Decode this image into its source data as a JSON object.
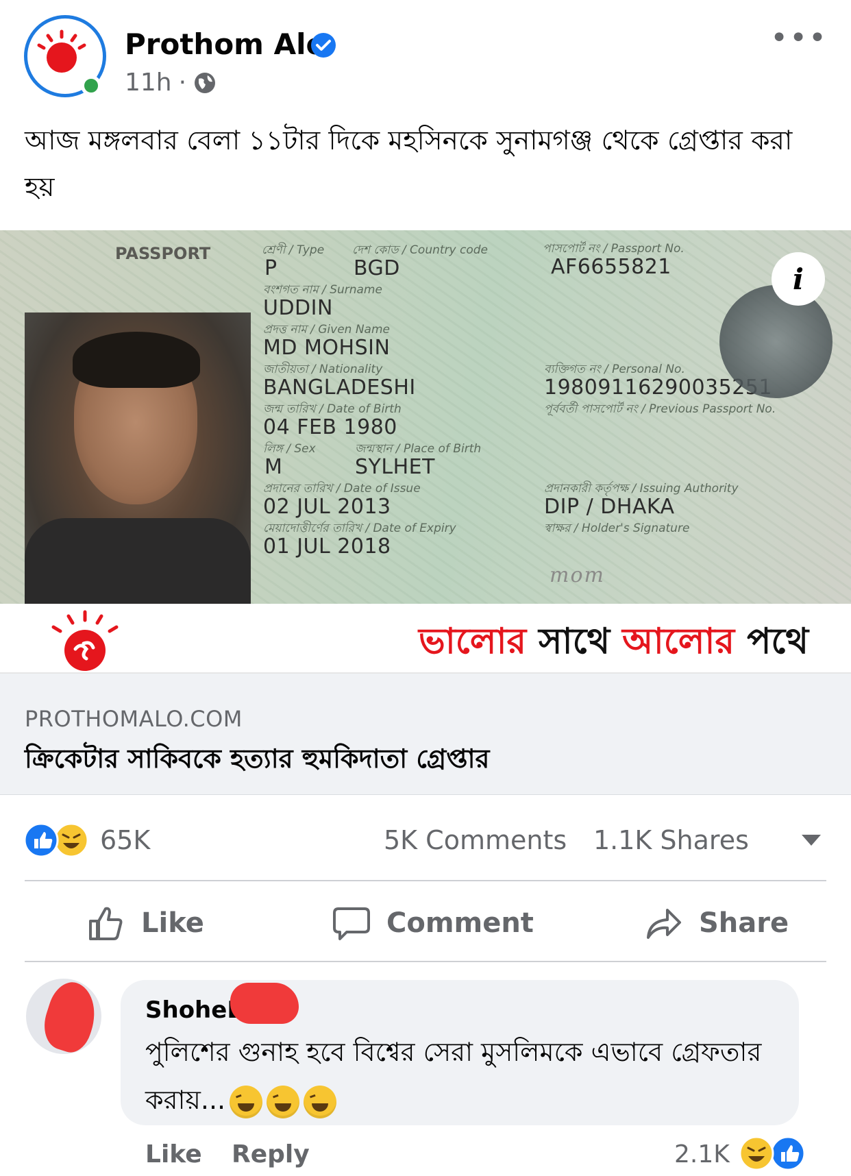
{
  "post": {
    "page_name": "Prothom Alo",
    "time": "11h",
    "separator": "·",
    "more": "•••",
    "caption": "আজ মঙ্গলবার বেলা ১১টার দিকে মহসিনকে সুনামগঞ্জ থেকে গ্রেপ্তার করা হয়"
  },
  "passport": {
    "header": "PASSPORT",
    "type_label": "শ্রেণী / Type",
    "type": "P",
    "country_label": "দেশ কোড / Country code",
    "country": "BGD",
    "number_label": "পাসপোর্ট নং / Passport No.",
    "number": "AF6655821",
    "surname_label": "বংশগত নাম / Surname",
    "surname": "UDDIN",
    "given_label": "প্রদত্ত নাম / Given Name",
    "given": "MD MOHSIN",
    "nationality_label": "জাতীয়তা / Nationality",
    "nationality": "BANGLADESHI",
    "personal_label": "ব্যক্তিগত নং / Personal No.",
    "personal": "19809116290035251",
    "dob_label": "জন্ম তারিখ / Date of Birth",
    "dob": "04 FEB 1980",
    "prev_label": "পূর্ববর্তী পাসপোর্ট নং / Previous Passport No.",
    "sex_label": "লিঙ্গ / Sex",
    "sex": "M",
    "pob_label": "জন্মস্থান / Place of Birth",
    "pob": "SYLHET",
    "issue_label": "প্রদানের তারিখ / Date of Issue",
    "issue": "02 JUL 2013",
    "authority_label": "প্রদানকারী কর্তৃপক্ষ / Issuing Authority",
    "authority": "DIP / DHAKA",
    "expiry_label": "মেয়াদোত্তীর্ণের তারিখ / Date of Expiry",
    "expiry": "01 JUL 2018",
    "signature_label": "স্বাক্ষর / Holder's Signature",
    "signature": "mom",
    "info": "i"
  },
  "banner": {
    "slogan_1": "ভালোর",
    "slogan_2": "সাথে",
    "slogan_3": "আলোর",
    "slogan_4": "পথে"
  },
  "link": {
    "domain": "PROTHOMALO.COM",
    "title": "ক্রিকেটার সাকিবকে হত্যার হুমকিদাতা গ্রেপ্তার"
  },
  "stats": {
    "reactions": "65K",
    "comments": "5K Comments",
    "shares": "1.1K Shares"
  },
  "actions": {
    "like": "Like",
    "comment": "Comment",
    "share": "Share"
  },
  "comment": {
    "author": "ShoheL",
    "text": "পুলিশের গুনাহ হবে বিশ্বের সেরা মুসলিমকে এভাবে গ্রেফতার করায়...",
    "like": "Like",
    "reply": "Reply",
    "reaction_count": "2.1K"
  },
  "colors": {
    "facebook_blue": "#1877f2",
    "brand_red": "#e5161d",
    "muted_text": "#65676b"
  }
}
